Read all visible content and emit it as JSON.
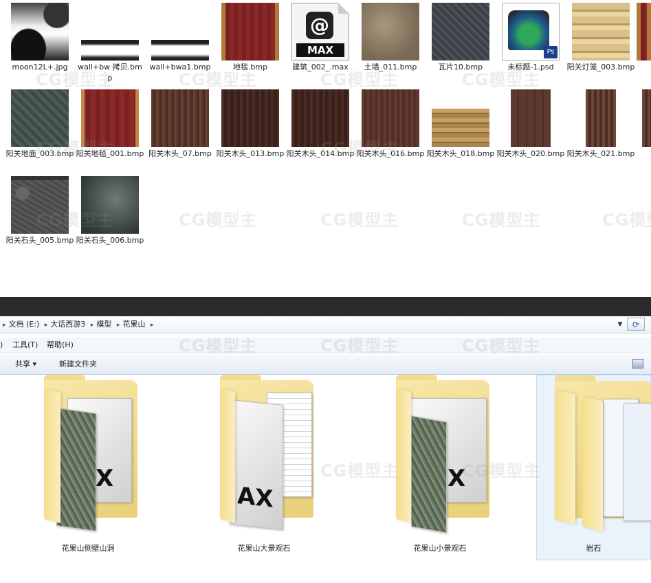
{
  "top_files": [
    {
      "name": "moon12L+.jpg",
      "thumb": "tx-moon"
    },
    {
      "name": "wall+bw 拷贝.bmp",
      "thumb": "tx-wall"
    },
    {
      "name": "wall+bwa1.bmp",
      "thumb": "tx-wall"
    },
    {
      "name": "地毯.bmp",
      "thumb": "tx-carpet"
    },
    {
      "name": "建筑_002_.max",
      "thumb": "max-doc",
      "max_label": "MAX"
    },
    {
      "name": "土墙_011.bmp",
      "thumb": "tx-soil"
    },
    {
      "name": "瓦片10.bmp",
      "thumb": "tx-tile"
    },
    {
      "name": "未标题-1.psd",
      "thumb": "psd-doc",
      "ps_badge": "Ps"
    },
    {
      "name": "阳关灯笼_003.bmp",
      "thumb": "tx-lantern"
    },
    {
      "name": "阳关地面_003.bmp",
      "thumb": "tx-ground"
    },
    {
      "name": "阳关地毯_001.bmp",
      "thumb": "tx-carpet2"
    },
    {
      "name": "阳关木头_07.bmp",
      "thumb": "tx-wood1"
    },
    {
      "name": "阳关木头_013.bmp",
      "thumb": "tx-wood2"
    },
    {
      "name": "阳关木头_014.bmp",
      "thumb": "tx-wood2"
    },
    {
      "name": "阳关木头_016.bmp",
      "thumb": "tx-wood3"
    },
    {
      "name": "阳关木头_018.bmp",
      "thumb": "tx-wood4"
    },
    {
      "name": "阳关木头_020.bmp",
      "thumb": "tx-wood5"
    },
    {
      "name": "阳关木头_021.bmp",
      "thumb": "tx-wood6"
    },
    {
      "name": "阳关石头_005.bmp",
      "thumb": "tx-stone1"
    },
    {
      "name": "阳关石头_006.bmp",
      "thumb": "tx-stone2"
    }
  ],
  "explorer": {
    "breadcrumb": [
      "文档 (E:)",
      "大话西游3",
      "模型",
      "花果山"
    ],
    "menu": [
      "工具(T)",
      "帮助(H)"
    ],
    "menu_left_fragment": ")",
    "toolbar": {
      "share": "共享 ▾",
      "new_folder": "新建文件夹"
    },
    "refresh_glyph": "⟳",
    "folders": [
      {
        "name": "花果山侧壁山洞",
        "contents": "texture-and-max"
      },
      {
        "name": "花果山大景观石",
        "contents": "max-and-lined-doc"
      },
      {
        "name": "花果山小景观石",
        "contents": "max-and-texture"
      },
      {
        "name": "岩石",
        "contents": "documents",
        "selected": true
      }
    ]
  },
  "watermark": "CG模型主",
  "colors": {
    "explorer_bg": "#ffffff",
    "separator": "#2b2b2b",
    "folder_yellow": "#f1dc92"
  }
}
